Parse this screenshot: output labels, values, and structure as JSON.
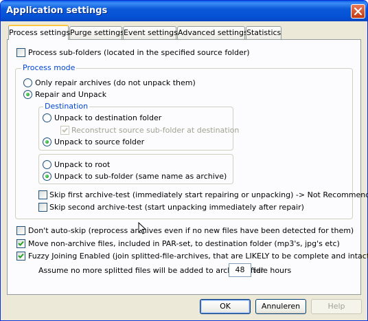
{
  "window": {
    "title": "Application settings"
  },
  "tabs": [
    "Process settings",
    "Purge settings",
    "Event settings",
    "Advanced settings",
    "Statistics"
  ],
  "process_subfolders": {
    "label": "Process sub-folders (located in the specified source folder)",
    "checked": false
  },
  "process_mode": {
    "title": "Process mode",
    "only_repair": {
      "label": "Only repair archives (do not unpack them)",
      "selected": false
    },
    "repair_unpack": {
      "label": "Repair and Unpack",
      "selected": true
    },
    "destination": {
      "title": "Destination",
      "to_destination": {
        "label": "Unpack to destination folder",
        "selected": false
      },
      "reconstruct": {
        "label": "Reconstruct source sub-folder at destination",
        "checked": true,
        "enabled": false
      },
      "to_source": {
        "label": "Unpack to source folder",
        "selected": true
      }
    },
    "location": {
      "to_root": {
        "label": "Unpack to root",
        "selected": false
      },
      "to_subfolder": {
        "label": "Unpack to sub-folder (same name as archive)",
        "selected": true
      }
    },
    "skip_first": {
      "label": "Skip first archive-test (immediately start repairing or unpacking) -> Not Recommended",
      "checked": false
    },
    "skip_second": {
      "label": "Skip second archive-test (start unpacking immediately after repair)",
      "checked": false
    }
  },
  "dont_autoskip": {
    "label": "Don't auto-skip (reprocess archives even if no new files have been detected for them)",
    "checked": false
  },
  "move_nonarchive": {
    "label": "Move non-archive files, included in PAR-set, to destination folder (mp3's, jpg's etc)",
    "checked": true
  },
  "fuzzy_joining": {
    "label": "Fuzzy Joining Enabled (join splitted-file-archives, that are LIKELY to be complete and intact)",
    "checked": true
  },
  "idle": {
    "prefix": "Assume no more splitted files will be added to archive after",
    "value": "48",
    "suffix": "idle hours"
  },
  "buttons": {
    "ok": "OK",
    "cancel": "Annuleren",
    "help": "Help"
  },
  "colors": {
    "title_bar": "#0a5fe6",
    "group_label": "#0046d5",
    "radio_dot": "#21a121",
    "active_tab_accent": "#ffc83c"
  }
}
